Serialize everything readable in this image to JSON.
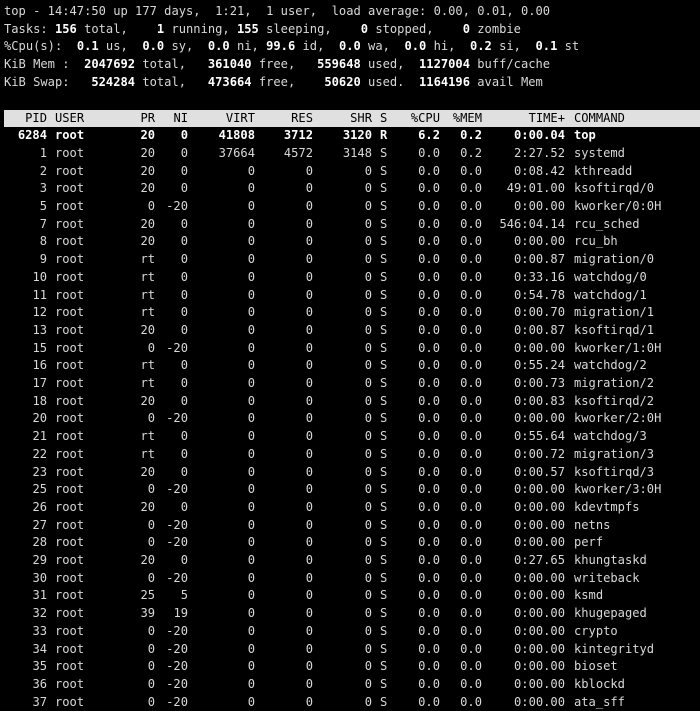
{
  "summary": {
    "line1": {
      "prefix": "top - 14:47:50 up 177 days,  1:21,  1 user,  load average: 0.00, 0.01, 0.00"
    },
    "tasks": {
      "label": "Tasks:",
      "total": "156",
      "running": "1",
      "sleeping": "155",
      "stopped": "0",
      "zombie": "0"
    },
    "cpu": {
      "label": "%Cpu(s):",
      "us": "0.1",
      "sy": "0.0",
      "ni": "0.0",
      "id": "99.6",
      "wa": "0.0",
      "hi": "0.0",
      "si": "0.2",
      "st": "0.1"
    },
    "mem": {
      "label": "KiB Mem :",
      "total": "2047692",
      "free": "361040",
      "used": "559648",
      "buff_cache": "1127004"
    },
    "swap": {
      "label": "KiB Swap:",
      "total": "524284",
      "free": "473664",
      "used": "50620",
      "avail_mem": "1164196"
    }
  },
  "columns": [
    "PID",
    "USER",
    "PR",
    "NI",
    "VIRT",
    "RES",
    "SHR",
    "S",
    "%CPU",
    "%MEM",
    "TIME+",
    "COMMAND"
  ],
  "processes": [
    {
      "pid": "6284",
      "user": "root",
      "pr": "20",
      "ni": "0",
      "virt": "41808",
      "res": "3712",
      "shr": "3120",
      "s": "R",
      "cpu": "6.2",
      "mem": "0.2",
      "time": "0:00.04",
      "cmd": "top",
      "highlight": true
    },
    {
      "pid": "1",
      "user": "root",
      "pr": "20",
      "ni": "0",
      "virt": "37664",
      "res": "4572",
      "shr": "3148",
      "s": "S",
      "cpu": "0.0",
      "mem": "0.2",
      "time": "2:27.52",
      "cmd": "systemd"
    },
    {
      "pid": "2",
      "user": "root",
      "pr": "20",
      "ni": "0",
      "virt": "0",
      "res": "0",
      "shr": "0",
      "s": "S",
      "cpu": "0.0",
      "mem": "0.0",
      "time": "0:08.42",
      "cmd": "kthreadd"
    },
    {
      "pid": "3",
      "user": "root",
      "pr": "20",
      "ni": "0",
      "virt": "0",
      "res": "0",
      "shr": "0",
      "s": "S",
      "cpu": "0.0",
      "mem": "0.0",
      "time": "49:01.00",
      "cmd": "ksoftirqd/0"
    },
    {
      "pid": "5",
      "user": "root",
      "pr": "0",
      "ni": "-20",
      "virt": "0",
      "res": "0",
      "shr": "0",
      "s": "S",
      "cpu": "0.0",
      "mem": "0.0",
      "time": "0:00.00",
      "cmd": "kworker/0:0H"
    },
    {
      "pid": "7",
      "user": "root",
      "pr": "20",
      "ni": "0",
      "virt": "0",
      "res": "0",
      "shr": "0",
      "s": "S",
      "cpu": "0.0",
      "mem": "0.0",
      "time": "546:04.14",
      "cmd": "rcu_sched"
    },
    {
      "pid": "8",
      "user": "root",
      "pr": "20",
      "ni": "0",
      "virt": "0",
      "res": "0",
      "shr": "0",
      "s": "S",
      "cpu": "0.0",
      "mem": "0.0",
      "time": "0:00.00",
      "cmd": "rcu_bh"
    },
    {
      "pid": "9",
      "user": "root",
      "pr": "rt",
      "ni": "0",
      "virt": "0",
      "res": "0",
      "shr": "0",
      "s": "S",
      "cpu": "0.0",
      "mem": "0.0",
      "time": "0:00.87",
      "cmd": "migration/0"
    },
    {
      "pid": "10",
      "user": "root",
      "pr": "rt",
      "ni": "0",
      "virt": "0",
      "res": "0",
      "shr": "0",
      "s": "S",
      "cpu": "0.0",
      "mem": "0.0",
      "time": "0:33.16",
      "cmd": "watchdog/0"
    },
    {
      "pid": "11",
      "user": "root",
      "pr": "rt",
      "ni": "0",
      "virt": "0",
      "res": "0",
      "shr": "0",
      "s": "S",
      "cpu": "0.0",
      "mem": "0.0",
      "time": "0:54.78",
      "cmd": "watchdog/1"
    },
    {
      "pid": "12",
      "user": "root",
      "pr": "rt",
      "ni": "0",
      "virt": "0",
      "res": "0",
      "shr": "0",
      "s": "S",
      "cpu": "0.0",
      "mem": "0.0",
      "time": "0:00.70",
      "cmd": "migration/1"
    },
    {
      "pid": "13",
      "user": "root",
      "pr": "20",
      "ni": "0",
      "virt": "0",
      "res": "0",
      "shr": "0",
      "s": "S",
      "cpu": "0.0",
      "mem": "0.0",
      "time": "0:00.87",
      "cmd": "ksoftirqd/1"
    },
    {
      "pid": "15",
      "user": "root",
      "pr": "0",
      "ni": "-20",
      "virt": "0",
      "res": "0",
      "shr": "0",
      "s": "S",
      "cpu": "0.0",
      "mem": "0.0",
      "time": "0:00.00",
      "cmd": "kworker/1:0H"
    },
    {
      "pid": "16",
      "user": "root",
      "pr": "rt",
      "ni": "0",
      "virt": "0",
      "res": "0",
      "shr": "0",
      "s": "S",
      "cpu": "0.0",
      "mem": "0.0",
      "time": "0:55.24",
      "cmd": "watchdog/2"
    },
    {
      "pid": "17",
      "user": "root",
      "pr": "rt",
      "ni": "0",
      "virt": "0",
      "res": "0",
      "shr": "0",
      "s": "S",
      "cpu": "0.0",
      "mem": "0.0",
      "time": "0:00.73",
      "cmd": "migration/2"
    },
    {
      "pid": "18",
      "user": "root",
      "pr": "20",
      "ni": "0",
      "virt": "0",
      "res": "0",
      "shr": "0",
      "s": "S",
      "cpu": "0.0",
      "mem": "0.0",
      "time": "0:00.83",
      "cmd": "ksoftirqd/2"
    },
    {
      "pid": "20",
      "user": "root",
      "pr": "0",
      "ni": "-20",
      "virt": "0",
      "res": "0",
      "shr": "0",
      "s": "S",
      "cpu": "0.0",
      "mem": "0.0",
      "time": "0:00.00",
      "cmd": "kworker/2:0H"
    },
    {
      "pid": "21",
      "user": "root",
      "pr": "rt",
      "ni": "0",
      "virt": "0",
      "res": "0",
      "shr": "0",
      "s": "S",
      "cpu": "0.0",
      "mem": "0.0",
      "time": "0:55.64",
      "cmd": "watchdog/3"
    },
    {
      "pid": "22",
      "user": "root",
      "pr": "rt",
      "ni": "0",
      "virt": "0",
      "res": "0",
      "shr": "0",
      "s": "S",
      "cpu": "0.0",
      "mem": "0.0",
      "time": "0:00.72",
      "cmd": "migration/3"
    },
    {
      "pid": "23",
      "user": "root",
      "pr": "20",
      "ni": "0",
      "virt": "0",
      "res": "0",
      "shr": "0",
      "s": "S",
      "cpu": "0.0",
      "mem": "0.0",
      "time": "0:00.57",
      "cmd": "ksoftirqd/3"
    },
    {
      "pid": "25",
      "user": "root",
      "pr": "0",
      "ni": "-20",
      "virt": "0",
      "res": "0",
      "shr": "0",
      "s": "S",
      "cpu": "0.0",
      "mem": "0.0",
      "time": "0:00.00",
      "cmd": "kworker/3:0H"
    },
    {
      "pid": "26",
      "user": "root",
      "pr": "20",
      "ni": "0",
      "virt": "0",
      "res": "0",
      "shr": "0",
      "s": "S",
      "cpu": "0.0",
      "mem": "0.0",
      "time": "0:00.00",
      "cmd": "kdevtmpfs"
    },
    {
      "pid": "27",
      "user": "root",
      "pr": "0",
      "ni": "-20",
      "virt": "0",
      "res": "0",
      "shr": "0",
      "s": "S",
      "cpu": "0.0",
      "mem": "0.0",
      "time": "0:00.00",
      "cmd": "netns"
    },
    {
      "pid": "28",
      "user": "root",
      "pr": "0",
      "ni": "-20",
      "virt": "0",
      "res": "0",
      "shr": "0",
      "s": "S",
      "cpu": "0.0",
      "mem": "0.0",
      "time": "0:00.00",
      "cmd": "perf"
    },
    {
      "pid": "29",
      "user": "root",
      "pr": "20",
      "ni": "0",
      "virt": "0",
      "res": "0",
      "shr": "0",
      "s": "S",
      "cpu": "0.0",
      "mem": "0.0",
      "time": "0:27.65",
      "cmd": "khungtaskd"
    },
    {
      "pid": "30",
      "user": "root",
      "pr": "0",
      "ni": "-20",
      "virt": "0",
      "res": "0",
      "shr": "0",
      "s": "S",
      "cpu": "0.0",
      "mem": "0.0",
      "time": "0:00.00",
      "cmd": "writeback"
    },
    {
      "pid": "31",
      "user": "root",
      "pr": "25",
      "ni": "5",
      "virt": "0",
      "res": "0",
      "shr": "0",
      "s": "S",
      "cpu": "0.0",
      "mem": "0.0",
      "time": "0:00.00",
      "cmd": "ksmd"
    },
    {
      "pid": "32",
      "user": "root",
      "pr": "39",
      "ni": "19",
      "virt": "0",
      "res": "0",
      "shr": "0",
      "s": "S",
      "cpu": "0.0",
      "mem": "0.0",
      "time": "0:00.00",
      "cmd": "khugepaged"
    },
    {
      "pid": "33",
      "user": "root",
      "pr": "0",
      "ni": "-20",
      "virt": "0",
      "res": "0",
      "shr": "0",
      "s": "S",
      "cpu": "0.0",
      "mem": "0.0",
      "time": "0:00.00",
      "cmd": "crypto"
    },
    {
      "pid": "34",
      "user": "root",
      "pr": "0",
      "ni": "-20",
      "virt": "0",
      "res": "0",
      "shr": "0",
      "s": "S",
      "cpu": "0.0",
      "mem": "0.0",
      "time": "0:00.00",
      "cmd": "kintegrityd"
    },
    {
      "pid": "35",
      "user": "root",
      "pr": "0",
      "ni": "-20",
      "virt": "0",
      "res": "0",
      "shr": "0",
      "s": "S",
      "cpu": "0.0",
      "mem": "0.0",
      "time": "0:00.00",
      "cmd": "bioset"
    },
    {
      "pid": "36",
      "user": "root",
      "pr": "0",
      "ni": "-20",
      "virt": "0",
      "res": "0",
      "shr": "0",
      "s": "S",
      "cpu": "0.0",
      "mem": "0.0",
      "time": "0:00.00",
      "cmd": "kblockd"
    },
    {
      "pid": "37",
      "user": "root",
      "pr": "0",
      "ni": "-20",
      "virt": "0",
      "res": "0",
      "shr": "0",
      "s": "S",
      "cpu": "0.0",
      "mem": "0.0",
      "time": "0:00.00",
      "cmd": "ata_sff"
    }
  ]
}
